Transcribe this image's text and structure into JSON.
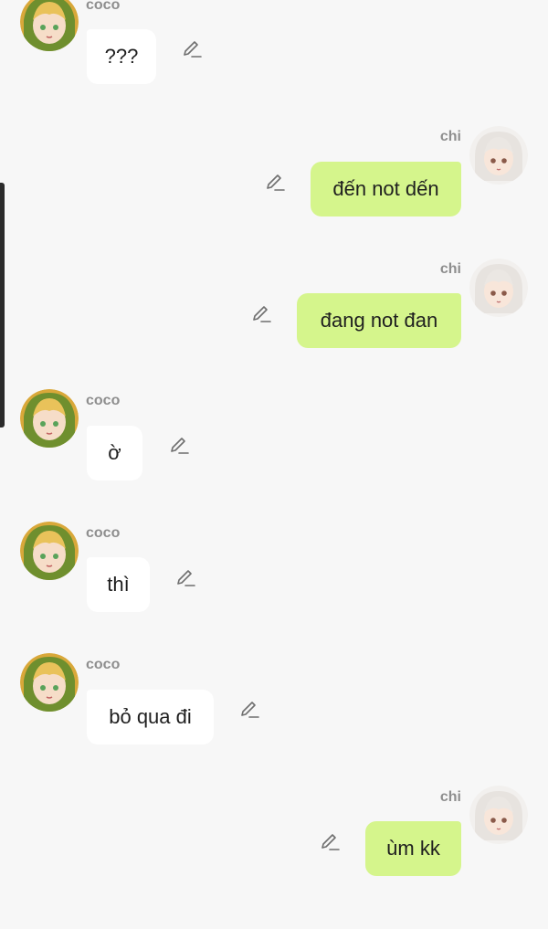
{
  "colors": {
    "background": "#f7f7f7",
    "bubble_them": "#ffffff",
    "bubble_me": "#d5f58c",
    "sender_name": "#8e8e8e",
    "icon": "#6f6f6f"
  },
  "users": {
    "coco": {
      "name": "coco",
      "avatar_icon": "blonde-girl-avatar"
    },
    "chi": {
      "name": "chi",
      "avatar_icon": "white-hair-girl-avatar"
    }
  },
  "messages": [
    {
      "sender": "coco",
      "text": "???",
      "side": "left"
    },
    {
      "sender": "chi",
      "text": "đến not dến",
      "side": "right"
    },
    {
      "sender": "chi",
      "text": "đang not đan",
      "side": "right"
    },
    {
      "sender": "coco",
      "text": "ờ",
      "side": "left"
    },
    {
      "sender": "coco",
      "text": "thì",
      "side": "left"
    },
    {
      "sender": "coco",
      "text": "bỏ qua đi",
      "side": "left"
    },
    {
      "sender": "chi",
      "text": "ùm kk",
      "side": "right"
    }
  ]
}
